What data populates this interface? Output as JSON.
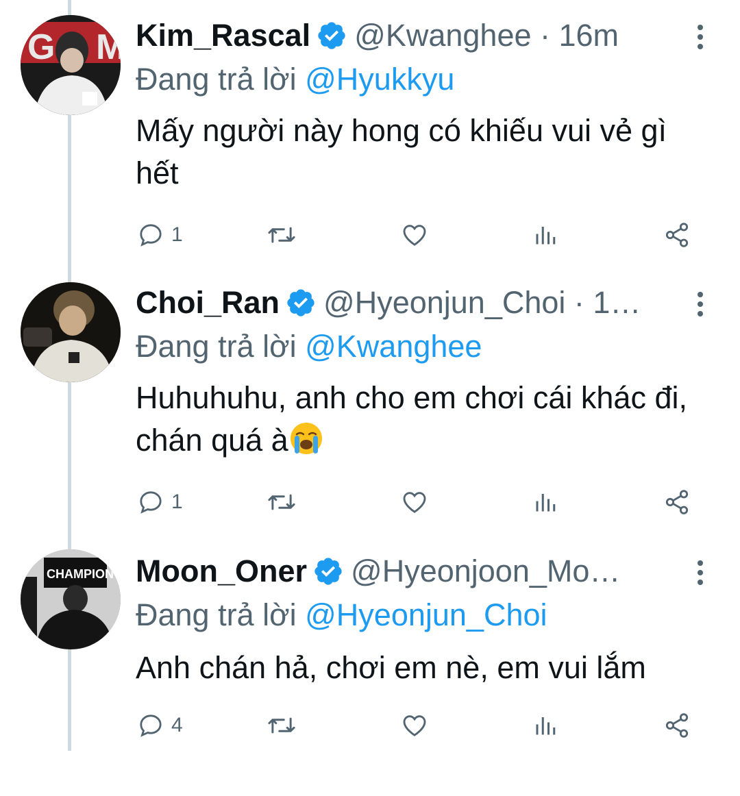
{
  "tweets": [
    {
      "name": "Kim_Rascal",
      "handle": "@Kwanghee · 16m",
      "replying_label": "Đang trả lời ",
      "replying_to": "@Hyukkyu",
      "text": "Mấy người này hong có khiếu vui vẻ gì hết",
      "replies": "1"
    },
    {
      "name": "Choi_Ran",
      "handle": "@Hyeonjun_Choi · 1…",
      "replying_label": "Đang trả lời ",
      "replying_to": "@Kwanghee",
      "text": "Huhuhuhu, anh cho em chơi cái khác đi, chán quá à",
      "replies": "1"
    },
    {
      "name": "Moon_Oner",
      "handle": "@Hyeonjoon_Mo…",
      "replying_label": "Đang trả lời ",
      "replying_to": "@Hyeonjun_Choi",
      "text": "Anh chán hả, chơi em nè, em vui lắm",
      "replies": "4"
    }
  ],
  "avatar_3_text": "CHAMPION",
  "icons": [
    "reply-icon",
    "retweet-icon",
    "like-icon",
    "views-icon",
    "share-icon",
    "verified-badge-icon",
    "more-options-icon",
    "crying-face-emoji"
  ],
  "colors": {
    "accent": "#1d9bf0",
    "muted": "#536471",
    "text": "#0f1419",
    "thread_line": "#cfd9de"
  }
}
